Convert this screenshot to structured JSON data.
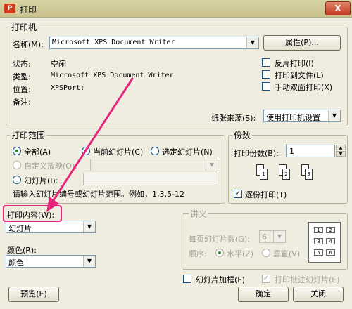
{
  "window": {
    "title": "打印",
    "app_icon": "P",
    "close": "X"
  },
  "printer": {
    "group_label": "打印机",
    "name_label": "名称(M):",
    "name_value": "Microsoft XPS Document Writer",
    "props_button": "属性(P)...",
    "status_label": "状态:",
    "status_value": "空闲",
    "type_label": "类型:",
    "type_value": "Microsoft XPS Document Writer",
    "location_label": "位置:",
    "location_value": "XPSPort:",
    "comment_label": "备注:",
    "reverse_print": "反片打印(I)",
    "print_to_file": "打印到文件(L)",
    "manual_duplex": "手动双面打印(X)",
    "paper_source_label": "纸张来源(S):",
    "paper_source_value": "使用打印机设置"
  },
  "range": {
    "group_label": "打印范围",
    "all": "全部(A)",
    "current": "当前幻灯片(C)",
    "selected": "选定幻灯片(N)",
    "custom": "自定义放映(O):",
    "slides": "幻灯片(I):",
    "hint": "请输入幻灯片编号或幻灯片范围。例如，1,3,5-12"
  },
  "copies": {
    "group_label": "份数",
    "count_label": "打印份数(B):",
    "count_value": "1",
    "collate": "逐份打印(T)",
    "sheet_labels": [
      "1",
      "2",
      "3"
    ]
  },
  "content": {
    "label": "打印内容(W):",
    "value": "幻灯片",
    "color_label": "颜色(R):",
    "color_value": "颜色"
  },
  "handouts": {
    "group_label": "讲义",
    "per_page_label": "每页幻灯片数(G):",
    "per_page_value": "6",
    "order_label": "顺序:",
    "horizontal": "水平(Z)",
    "vertical": "垂直(V)",
    "preview_cells": [
      "1",
      "2",
      "3",
      "4",
      "5",
      "6"
    ]
  },
  "footer": {
    "frame_slides": "幻灯片加框(F)",
    "print_comments": "打印批注幻灯片(E)",
    "preview": "预览(E)",
    "ok": "确定",
    "close": "关闭"
  },
  "colors": {
    "annotation": "#e6247a"
  }
}
